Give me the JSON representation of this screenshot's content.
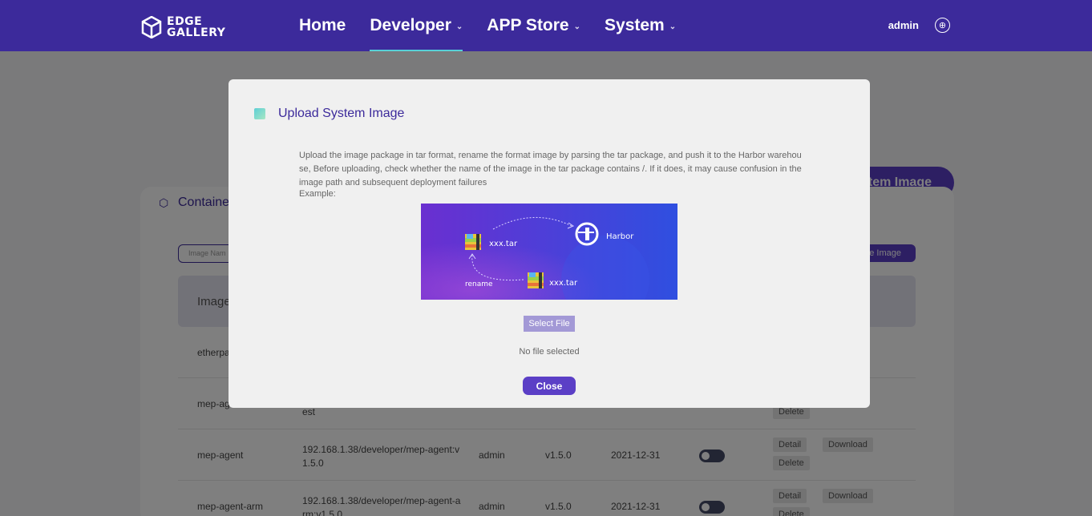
{
  "header": {
    "logo_line1": "EDGE",
    "logo_line2": "GALLERY",
    "nav": [
      {
        "label": "Home"
      },
      {
        "label": "Developer"
      },
      {
        "label": "APP Store"
      },
      {
        "label": "System"
      }
    ],
    "user": "admin",
    "lang_icon": "globe-icon"
  },
  "page": {
    "upload_button_label": "tem Image",
    "card_title": "Containe",
    "search_placeholder": "Image Nam",
    "upload_small_label": "e Image",
    "table_header_first": "Image",
    "rows": [
      {
        "name": "etherpa",
        "path": "",
        "user": "",
        "version": "",
        "date": "",
        "ops": []
      },
      {
        "name": "mep-ag",
        "path": "est",
        "user": "",
        "version": "",
        "date": "",
        "ops": [
          "Delete"
        ]
      },
      {
        "name": "mep-agent",
        "path": "192.168.1.38/developer/mep-agent:v1.5.0",
        "user": "admin",
        "version": "v1.5.0",
        "date": "2021-12-31",
        "ops": [
          "Detail",
          "Download",
          "Delete"
        ]
      },
      {
        "name": "mep-agent-arm",
        "path": "192.168.1.38/developer/mep-agent-arm:v1.5.0",
        "user": "admin",
        "version": "v1.5.0",
        "date": "2021-12-31",
        "ops": [
          "Detail",
          "Download",
          "Delete"
        ]
      }
    ]
  },
  "modal": {
    "title": "Upload System Image",
    "description": "Upload the image package in tar format, rename the format image by parsing the tar package, and push it to the Harbor warehouse, Before uploading, check whether the name of the image in the tar package contains /. If it does, it may cause confusion in the image path and subsequent deployment failures",
    "example_label": "Example:",
    "diagram": {
      "file1": "xxx.tar",
      "harbor": "Harbor",
      "rename": "rename",
      "file2": "xxx.tar"
    },
    "select_file_label": "Select File",
    "no_file_text": "No file selected",
    "close_label": "Close"
  },
  "colors": {
    "header_bg": "#3c2a9b",
    "accent": "#5b3fc6",
    "nav_underline": "#58d0d8"
  }
}
